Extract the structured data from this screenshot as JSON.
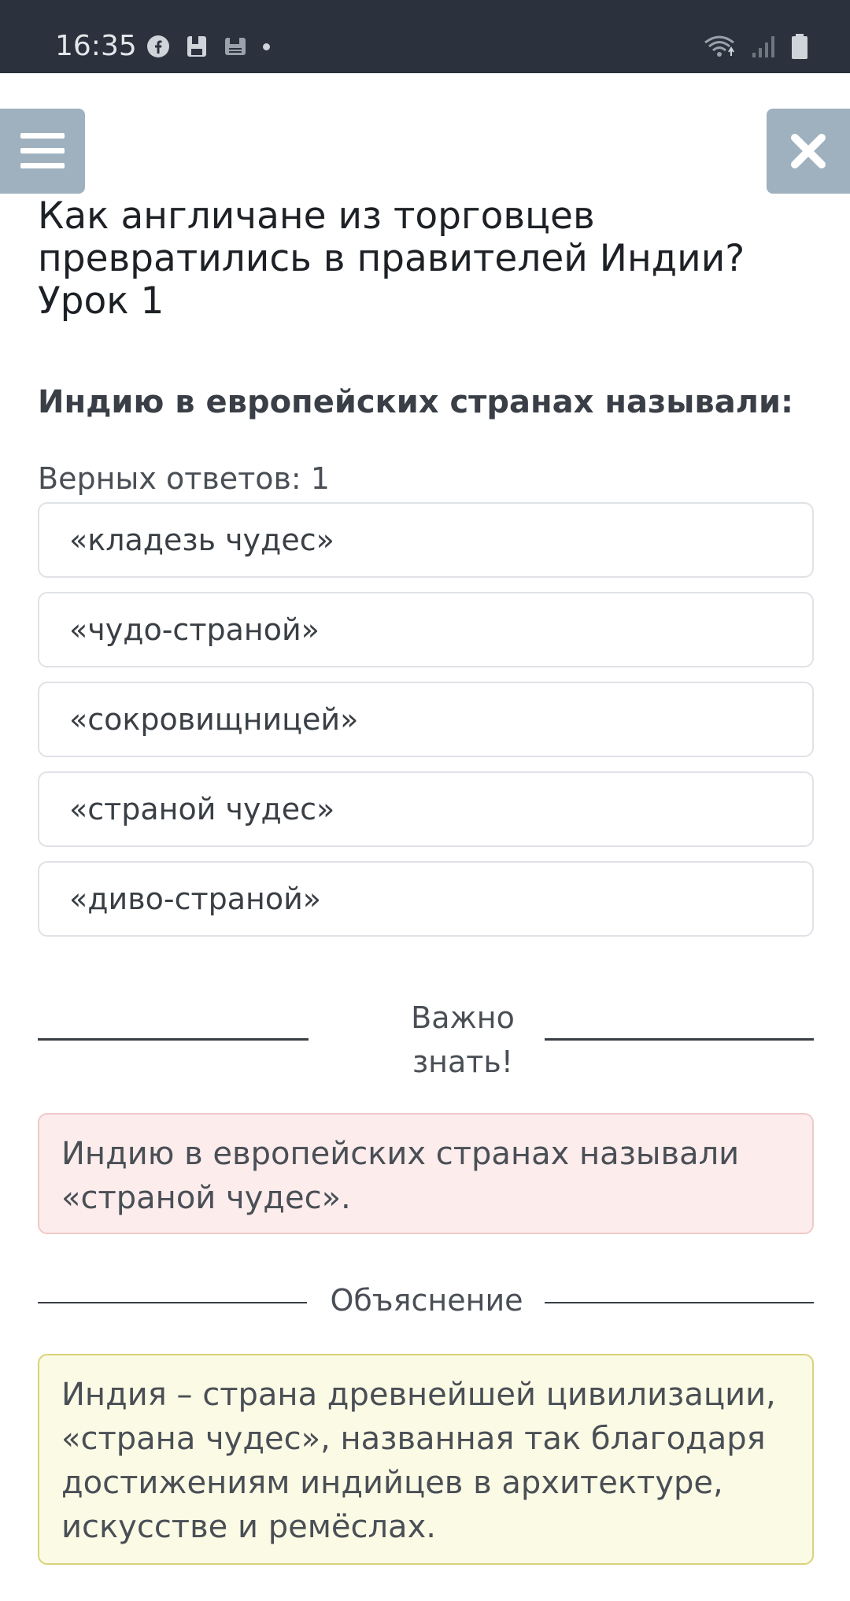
{
  "status_bar": {
    "time": "16:35",
    "icons": [
      "facebook-icon",
      "save-icon",
      "save-alt-icon",
      "dot-icon",
      "wifi-icon",
      "signal-icon",
      "battery-icon"
    ]
  },
  "header": {
    "menu_icon": "hamburger-icon",
    "close_icon": "close-icon",
    "title_lines": [
      "Как англичане из торговцев",
      "превратились в правителей Индии?",
      "Урок 1"
    ]
  },
  "question": {
    "text": "Индию в европейских странах называли:",
    "correct_count": "Верных ответов: 1",
    "options": [
      "«кладезь чудес»",
      "«чудо-страной»",
      "«сокровищницей»",
      "«страной чудес»",
      "«диво-страной»"
    ]
  },
  "important": {
    "heading_lines": [
      "Важно",
      "знать!"
    ],
    "text_lines": [
      "Индию в европейских странах называли",
      "«страной чудес»."
    ]
  },
  "explanation": {
    "label": "Объяснение",
    "text_lines": [
      "Индия – страна древнейшей цивилизации,",
      "«страна чудес», названная так благодаря",
      "достижениям индийцев в архитектуре,",
      "искусстве и ремёслах."
    ]
  },
  "colors": {
    "status_bar_bg": "#2b323d",
    "header_button_bg": "#9fb1bf",
    "important_bg": "#fcecec",
    "important_border": "#f0c9c9",
    "explanation_bg": "#fbfbe5",
    "explanation_border": "#d9d27a"
  }
}
